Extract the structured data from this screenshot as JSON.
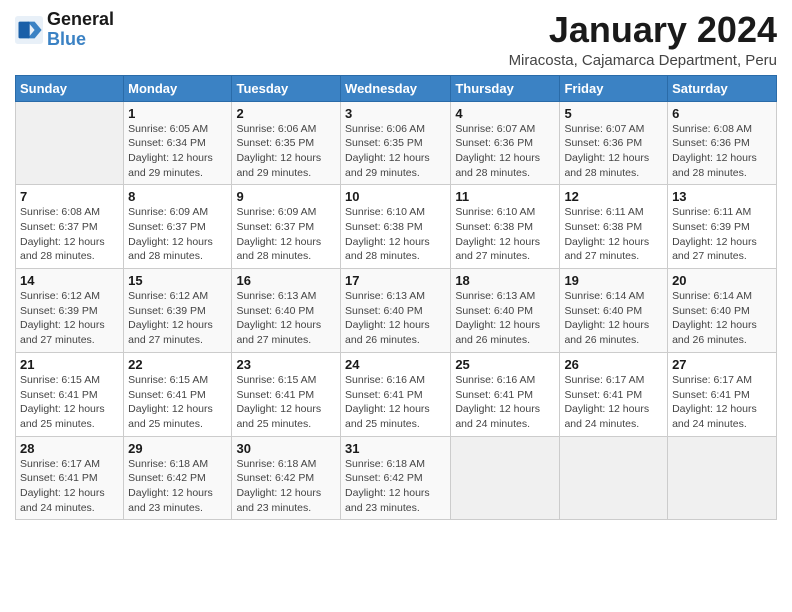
{
  "header": {
    "logo_general": "General",
    "logo_blue": "Blue",
    "title": "January 2024",
    "subtitle": "Miracosta, Cajamarca Department, Peru"
  },
  "weekdays": [
    "Sunday",
    "Monday",
    "Tuesday",
    "Wednesday",
    "Thursday",
    "Friday",
    "Saturday"
  ],
  "weeks": [
    [
      {
        "day": "",
        "sunrise": "",
        "sunset": "",
        "daylight": ""
      },
      {
        "day": "1",
        "sunrise": "Sunrise: 6:05 AM",
        "sunset": "Sunset: 6:34 PM",
        "daylight": "Daylight: 12 hours and 29 minutes."
      },
      {
        "day": "2",
        "sunrise": "Sunrise: 6:06 AM",
        "sunset": "Sunset: 6:35 PM",
        "daylight": "Daylight: 12 hours and 29 minutes."
      },
      {
        "day": "3",
        "sunrise": "Sunrise: 6:06 AM",
        "sunset": "Sunset: 6:35 PM",
        "daylight": "Daylight: 12 hours and 29 minutes."
      },
      {
        "day": "4",
        "sunrise": "Sunrise: 6:07 AM",
        "sunset": "Sunset: 6:36 PM",
        "daylight": "Daylight: 12 hours and 28 minutes."
      },
      {
        "day": "5",
        "sunrise": "Sunrise: 6:07 AM",
        "sunset": "Sunset: 6:36 PM",
        "daylight": "Daylight: 12 hours and 28 minutes."
      },
      {
        "day": "6",
        "sunrise": "Sunrise: 6:08 AM",
        "sunset": "Sunset: 6:36 PM",
        "daylight": "Daylight: 12 hours and 28 minutes."
      }
    ],
    [
      {
        "day": "7",
        "sunrise": "Sunrise: 6:08 AM",
        "sunset": "Sunset: 6:37 PM",
        "daylight": "Daylight: 12 hours and 28 minutes."
      },
      {
        "day": "8",
        "sunrise": "Sunrise: 6:09 AM",
        "sunset": "Sunset: 6:37 PM",
        "daylight": "Daylight: 12 hours and 28 minutes."
      },
      {
        "day": "9",
        "sunrise": "Sunrise: 6:09 AM",
        "sunset": "Sunset: 6:37 PM",
        "daylight": "Daylight: 12 hours and 28 minutes."
      },
      {
        "day": "10",
        "sunrise": "Sunrise: 6:10 AM",
        "sunset": "Sunset: 6:38 PM",
        "daylight": "Daylight: 12 hours and 28 minutes."
      },
      {
        "day": "11",
        "sunrise": "Sunrise: 6:10 AM",
        "sunset": "Sunset: 6:38 PM",
        "daylight": "Daylight: 12 hours and 27 minutes."
      },
      {
        "day": "12",
        "sunrise": "Sunrise: 6:11 AM",
        "sunset": "Sunset: 6:38 PM",
        "daylight": "Daylight: 12 hours and 27 minutes."
      },
      {
        "day": "13",
        "sunrise": "Sunrise: 6:11 AM",
        "sunset": "Sunset: 6:39 PM",
        "daylight": "Daylight: 12 hours and 27 minutes."
      }
    ],
    [
      {
        "day": "14",
        "sunrise": "Sunrise: 6:12 AM",
        "sunset": "Sunset: 6:39 PM",
        "daylight": "Daylight: 12 hours and 27 minutes."
      },
      {
        "day": "15",
        "sunrise": "Sunrise: 6:12 AM",
        "sunset": "Sunset: 6:39 PM",
        "daylight": "Daylight: 12 hours and 27 minutes."
      },
      {
        "day": "16",
        "sunrise": "Sunrise: 6:13 AM",
        "sunset": "Sunset: 6:40 PM",
        "daylight": "Daylight: 12 hours and 27 minutes."
      },
      {
        "day": "17",
        "sunrise": "Sunrise: 6:13 AM",
        "sunset": "Sunset: 6:40 PM",
        "daylight": "Daylight: 12 hours and 26 minutes."
      },
      {
        "day": "18",
        "sunrise": "Sunrise: 6:13 AM",
        "sunset": "Sunset: 6:40 PM",
        "daylight": "Daylight: 12 hours and 26 minutes."
      },
      {
        "day": "19",
        "sunrise": "Sunrise: 6:14 AM",
        "sunset": "Sunset: 6:40 PM",
        "daylight": "Daylight: 12 hours and 26 minutes."
      },
      {
        "day": "20",
        "sunrise": "Sunrise: 6:14 AM",
        "sunset": "Sunset: 6:40 PM",
        "daylight": "Daylight: 12 hours and 26 minutes."
      }
    ],
    [
      {
        "day": "21",
        "sunrise": "Sunrise: 6:15 AM",
        "sunset": "Sunset: 6:41 PM",
        "daylight": "Daylight: 12 hours and 25 minutes."
      },
      {
        "day": "22",
        "sunrise": "Sunrise: 6:15 AM",
        "sunset": "Sunset: 6:41 PM",
        "daylight": "Daylight: 12 hours and 25 minutes."
      },
      {
        "day": "23",
        "sunrise": "Sunrise: 6:15 AM",
        "sunset": "Sunset: 6:41 PM",
        "daylight": "Daylight: 12 hours and 25 minutes."
      },
      {
        "day": "24",
        "sunrise": "Sunrise: 6:16 AM",
        "sunset": "Sunset: 6:41 PM",
        "daylight": "Daylight: 12 hours and 25 minutes."
      },
      {
        "day": "25",
        "sunrise": "Sunrise: 6:16 AM",
        "sunset": "Sunset: 6:41 PM",
        "daylight": "Daylight: 12 hours and 24 minutes."
      },
      {
        "day": "26",
        "sunrise": "Sunrise: 6:17 AM",
        "sunset": "Sunset: 6:41 PM",
        "daylight": "Daylight: 12 hours and 24 minutes."
      },
      {
        "day": "27",
        "sunrise": "Sunrise: 6:17 AM",
        "sunset": "Sunset: 6:41 PM",
        "daylight": "Daylight: 12 hours and 24 minutes."
      }
    ],
    [
      {
        "day": "28",
        "sunrise": "Sunrise: 6:17 AM",
        "sunset": "Sunset: 6:41 PM",
        "daylight": "Daylight: 12 hours and 24 minutes."
      },
      {
        "day": "29",
        "sunrise": "Sunrise: 6:18 AM",
        "sunset": "Sunset: 6:42 PM",
        "daylight": "Daylight: 12 hours and 23 minutes."
      },
      {
        "day": "30",
        "sunrise": "Sunrise: 6:18 AM",
        "sunset": "Sunset: 6:42 PM",
        "daylight": "Daylight: 12 hours and 23 minutes."
      },
      {
        "day": "31",
        "sunrise": "Sunrise: 6:18 AM",
        "sunset": "Sunset: 6:42 PM",
        "daylight": "Daylight: 12 hours and 23 minutes."
      },
      {
        "day": "",
        "sunrise": "",
        "sunset": "",
        "daylight": ""
      },
      {
        "day": "",
        "sunrise": "",
        "sunset": "",
        "daylight": ""
      },
      {
        "day": "",
        "sunrise": "",
        "sunset": "",
        "daylight": ""
      }
    ]
  ]
}
